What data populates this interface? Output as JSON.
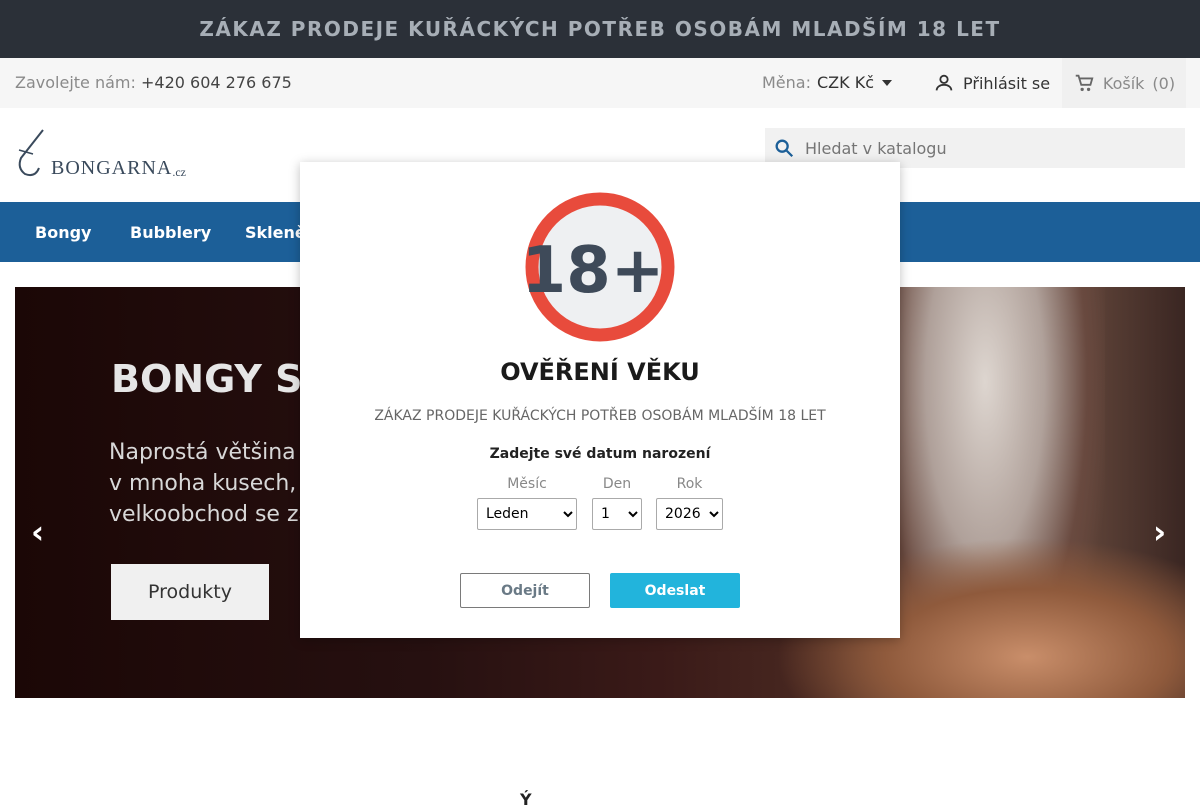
{
  "banner": {
    "text": "ZÁKAZ PRODEJE KUŘÁCKÝCH POTŘEB OSOBÁM MLADŠÍM 18 LET"
  },
  "infobar": {
    "call_label": "Zavolejte nám:",
    "phone": "+420 604 276 675",
    "currency_label": "Měna:",
    "currency_value": "CZK Kč",
    "login_label": "Přihlásit se",
    "cart_label": "Košík",
    "cart_count": "(0)"
  },
  "header": {
    "logo_main": "BONGARNA",
    "logo_suffix": ".cz",
    "search_placeholder": "Hledat v katalogu"
  },
  "nav": {
    "items": [
      {
        "label": "Bongy"
      },
      {
        "label": "Bubblery"
      },
      {
        "label": "Skleněn"
      }
    ]
  },
  "hero": {
    "title": "BONGY SK",
    "text_lines": [
      "Naprostá většina b",
      "v mnoha kusech, p",
      "velkoobchod se zá"
    ],
    "button_label": "Produkty",
    "prev_arrow": "‹",
    "next_arrow": "›"
  },
  "modal": {
    "badge_text": "18+",
    "title": "OVĚŘENÍ VĚKU",
    "notice": "ZÁKAZ PRODEJE KUŘÁCKÝCH POTŘEB OSOBÁM MLADŠÍM 18 LET",
    "prompt": "Zadejte své datum narození",
    "month_label": "Měsíc",
    "month_value": "Leden",
    "day_label": "Den",
    "day_value": "1",
    "year_label": "Rok",
    "year_value": "2026",
    "leave_label": "Odejít",
    "submit_label": "Odeslat"
  },
  "below": {
    "text": "Ý"
  },
  "colors": {
    "banner_bg": "#2b3038",
    "nav_bg": "#1c5f98",
    "submit_bg": "#22b4dc",
    "badge_ring": "#e84b3c"
  }
}
